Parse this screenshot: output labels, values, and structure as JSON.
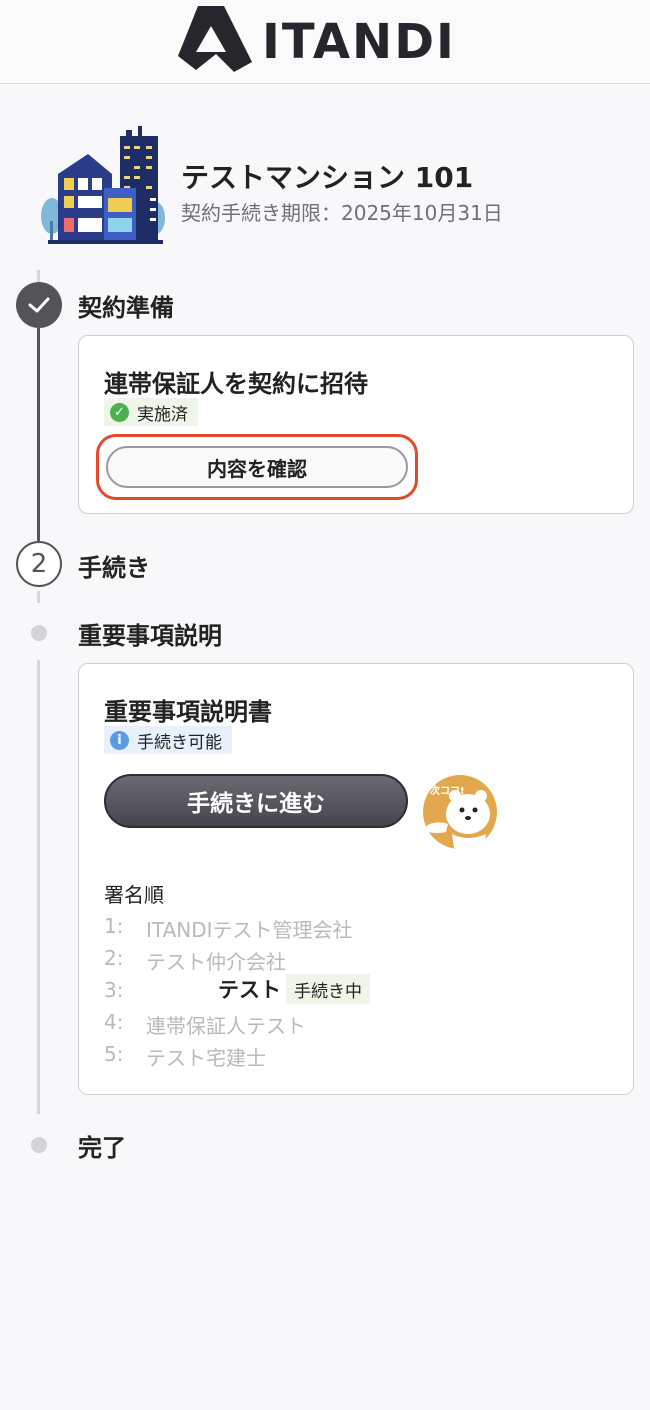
{
  "header": {
    "logo_text": "ITANDI"
  },
  "property": {
    "name": "テストマンション 101",
    "deadline": "契約手続き期限：2025年10月31日"
  },
  "steps": {
    "step1_label": "契約準備",
    "step2_number": "2",
    "step2_label": "手続き",
    "substep_label": "重要事項説明",
    "final_label": "完了"
  },
  "guarantor_card": {
    "title": "連帯保証人を契約に招待",
    "status": "実施済",
    "button_label": "内容を確認"
  },
  "explanation_card": {
    "title": "重要事項説明書",
    "status": "手続き可能",
    "button_label": "手続きに進む",
    "mascot_text": "次ココ!",
    "signing_order_title": "署名順",
    "signing_order": [
      {
        "num": "1:",
        "name": "ITANDIテスト管理会社"
      },
      {
        "num": "2:",
        "name": "テスト仲介会社"
      },
      {
        "num": "3:",
        "name": "テスト",
        "tag": "手続き中"
      },
      {
        "num": "4:",
        "name": "連帯保証人テスト"
      },
      {
        "num": "5:",
        "name": "テスト宅建士"
      }
    ]
  },
  "colors": {
    "highlight_border": "#e14a2c",
    "primary_button": "#55545a",
    "success_green": "#4caf50",
    "info_blue": "#5b9be6",
    "mascot_bg": "#e3a84e"
  },
  "icons": {
    "step_done": "check-icon",
    "status_done": "check-circle-icon",
    "status_info": "info-icon"
  }
}
